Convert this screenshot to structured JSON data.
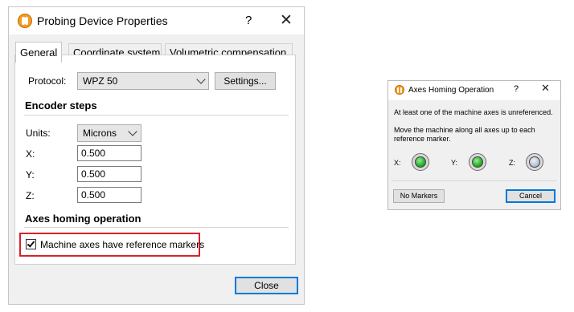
{
  "probing_dialog": {
    "title": "Probing Device Properties",
    "help": "?",
    "close": "✕",
    "tabs": [
      "General",
      "Coordinate system",
      "Volumetric compensation"
    ],
    "protocol_label": "Protocol:",
    "protocol_value": "WPZ 50",
    "settings_button": "Settings...",
    "encoder_heading": "Encoder steps",
    "units_label": "Units:",
    "units_value": "Microns",
    "x_label": "X:",
    "x_value": "0.500",
    "y_label": "Y:",
    "y_value": "0.500",
    "z_label": "Z:",
    "z_value": "0.500",
    "homing_heading": "Axes homing operation",
    "checkbox_label": "Machine axes have reference markers",
    "checkbox_checked": true,
    "close_button": "Close"
  },
  "homing_dialog": {
    "title": "Axes Homing Operation",
    "help": "?",
    "close": "✕",
    "message_1": "At least one of the machine axes is unreferenced.",
    "message_2_line1": "Move the machine along all axes up to each",
    "message_2_line2": "reference marker.",
    "axes": [
      {
        "label": "X:",
        "state": "green"
      },
      {
        "label": "Y:",
        "state": "green"
      },
      {
        "label": "Z:",
        "state": "gray"
      }
    ],
    "no_markers_button": "No Markers",
    "cancel_button": "Cancel"
  },
  "colors": {
    "highlight": "#d6232a",
    "focus_blue": "#0078d7",
    "led_green": "#2db52d",
    "app_icon": "#f39c1f"
  }
}
